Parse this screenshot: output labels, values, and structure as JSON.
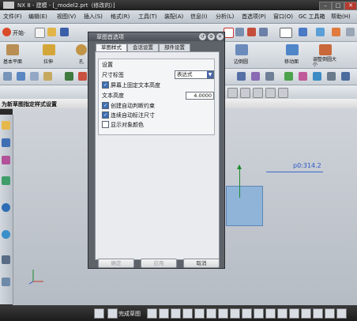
{
  "window": {
    "title": "NX 8 - 建模 - [_model2.prt（修改的）]",
    "min": "–",
    "max": "□",
    "close": "✕"
  },
  "menubar": {
    "items": [
      "文件(F)",
      "编辑(E)",
      "视图(V)",
      "插入(S)",
      "格式(R)",
      "工具(T)",
      "装配(A)",
      "信息(I)",
      "分析(L)",
      "首选项(P)",
      "窗口(O)",
      "GC 工具箱",
      "帮助(H)"
    ]
  },
  "toolbar1": {
    "start_label": "开始·"
  },
  "toolbar2": {
    "left_labels": [
      "基本平面",
      "拉伸",
      "孔"
    ],
    "right_labels": [
      "边倒圆",
      "移动面",
      "调整倒圆大小"
    ]
  },
  "taskstrip": {
    "label": "为新草图指定样式设置"
  },
  "dialog": {
    "title": "草图首选项",
    "tabs": [
      "草图样式",
      "会话设置",
      "部件设置"
    ],
    "group_title": "设置",
    "dim_label_caption": "尺寸标签",
    "dim_label_value": "表达式",
    "text_height_caption": "文本高度",
    "text_height_value": "4.0000",
    "options": [
      {
        "label": "屏幕上固定文本高度",
        "checked": true
      },
      {
        "label": "创建自动判断约束",
        "checked": true
      },
      {
        "label": "连续自动标注尺寸",
        "checked": true
      },
      {
        "label": "显示对象颜色",
        "checked": false
      }
    ],
    "buttons": {
      "ok": "确定",
      "apply": "应用",
      "cancel": "取消"
    }
  },
  "sketch": {
    "dimension_text": "p0:314.2"
  },
  "bottombar": {
    "finish_label": "完成草图"
  },
  "colors": {
    "sketch_fill": "#8fb4d8",
    "dimension": "#2b56c6",
    "axis_y": "#1c8b2d"
  }
}
